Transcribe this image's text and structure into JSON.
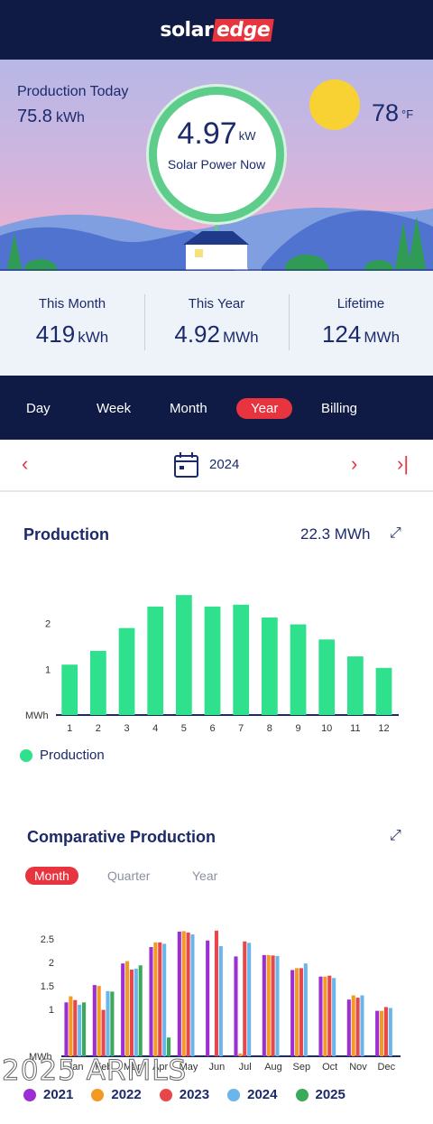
{
  "header": {
    "logo_a": "solar",
    "logo_b": "edge"
  },
  "hero": {
    "production_label": "Production Today",
    "production_value": "75.8",
    "production_unit": "kWh",
    "power_value": "4.97",
    "power_unit": "kW",
    "power_label": "Solar Power Now",
    "temperature": "78",
    "temperature_unit": "°F"
  },
  "stats": [
    {
      "title": "This Month",
      "value": "419",
      "unit": "kWh"
    },
    {
      "title": "This Year",
      "value": "4.92",
      "unit": "MWh"
    },
    {
      "title": "Lifetime",
      "value": "124",
      "unit": "MWh"
    }
  ],
  "tabs": [
    "Day",
    "Week",
    "Month",
    "Year",
    "Billing"
  ],
  "active_tab": "Year",
  "date": {
    "year": "2024"
  },
  "production": {
    "title": "Production",
    "total": "22.3 MWh",
    "legend": "Production",
    "color": "#2fe08c"
  },
  "comparative": {
    "title": "Comparative Production",
    "segments": [
      "Month",
      "Quarter",
      "Year"
    ],
    "active_segment": "Month"
  },
  "watermark": "2025 ARMLS",
  "chart_data": [
    {
      "type": "bar",
      "title": "Production",
      "categories": [
        "1",
        "2",
        "3",
        "4",
        "5",
        "6",
        "7",
        "8",
        "9",
        "10",
        "11",
        "12"
      ],
      "values": [
        1.1,
        1.4,
        1.9,
        2.37,
        2.62,
        2.37,
        2.41,
        2.13,
        1.98,
        1.65,
        1.28,
        1.03
      ],
      "ylabel": "MWh",
      "yticks": [
        "1",
        "2"
      ],
      "ylim": [
        0,
        2.8
      ],
      "color": "#2fe08c",
      "legend": "bottom-left"
    },
    {
      "type": "bar",
      "title": "Comparative Production",
      "categories": [
        "Jan",
        "Feb",
        "Mar",
        "Apr",
        "May",
        "Jun",
        "Jul",
        "Aug",
        "Sep",
        "Oct",
        "Nov",
        "Dec"
      ],
      "ylabel": "MWh",
      "yticks": [
        "1",
        "1.5",
        "2",
        "2.5"
      ],
      "ylim": [
        0,
        2.6
      ],
      "legend": "bottom",
      "series": [
        {
          "name": "2021",
          "color": "#9b2fd1",
          "values": [
            1.15,
            1.52,
            1.98,
            2.33,
            2.66,
            2.47,
            2.13,
            2.16,
            1.84,
            1.7,
            1.21,
            0.97
          ]
        },
        {
          "name": "2022",
          "color": "#f39a24",
          "values": [
            1.28,
            1.5,
            2.03,
            2.43,
            2.67,
            0.0,
            0.06,
            2.16,
            1.88,
            1.7,
            1.3,
            0.97
          ]
        },
        {
          "name": "2023",
          "color": "#e8474a",
          "values": [
            1.2,
            0.99,
            1.85,
            2.43,
            2.64,
            2.68,
            2.45,
            2.15,
            1.88,
            1.72,
            1.25,
            1.05
          ]
        },
        {
          "name": "2024",
          "color": "#6ab6ea",
          "values": [
            1.1,
            1.39,
            1.87,
            2.4,
            2.6,
            2.35,
            2.42,
            2.14,
            1.98,
            1.67,
            1.3,
            1.03
          ]
        },
        {
          "name": "2025",
          "color": "#3aa95a",
          "values": [
            1.15,
            1.38,
            1.94,
            0.4,
            null,
            null,
            null,
            null,
            null,
            null,
            null,
            null
          ]
        }
      ]
    }
  ]
}
